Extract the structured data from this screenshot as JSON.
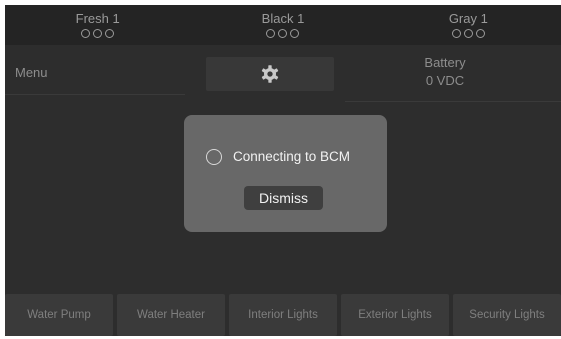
{
  "tanks": [
    {
      "name": "Fresh 1",
      "level_dots": 3,
      "filled_dots": 0
    },
    {
      "name": "Black 1",
      "level_dots": 3,
      "filled_dots": 0
    },
    {
      "name": "Gray 1",
      "level_dots": 3,
      "filled_dots": 0
    }
  ],
  "menu": {
    "label": "Menu"
  },
  "settings": {
    "icon": "gear-icon"
  },
  "battery": {
    "label": "Battery",
    "value": "0 VDC"
  },
  "modal": {
    "message": "Connecting to BCM",
    "spinner_icon": "spinner-icon",
    "dismiss_label": "Dismiss"
  },
  "controls": [
    {
      "label": "Water Pump"
    },
    {
      "label": "Water Heater"
    },
    {
      "label": "Interior Lights"
    },
    {
      "label": "Exterior Lights"
    },
    {
      "label": "Security Lights"
    }
  ],
  "colors": {
    "background": "#2d2d2d",
    "header": "#242424",
    "modal": "#686868",
    "button": "#3a3a3a",
    "dismiss": "#3f3f3f"
  }
}
